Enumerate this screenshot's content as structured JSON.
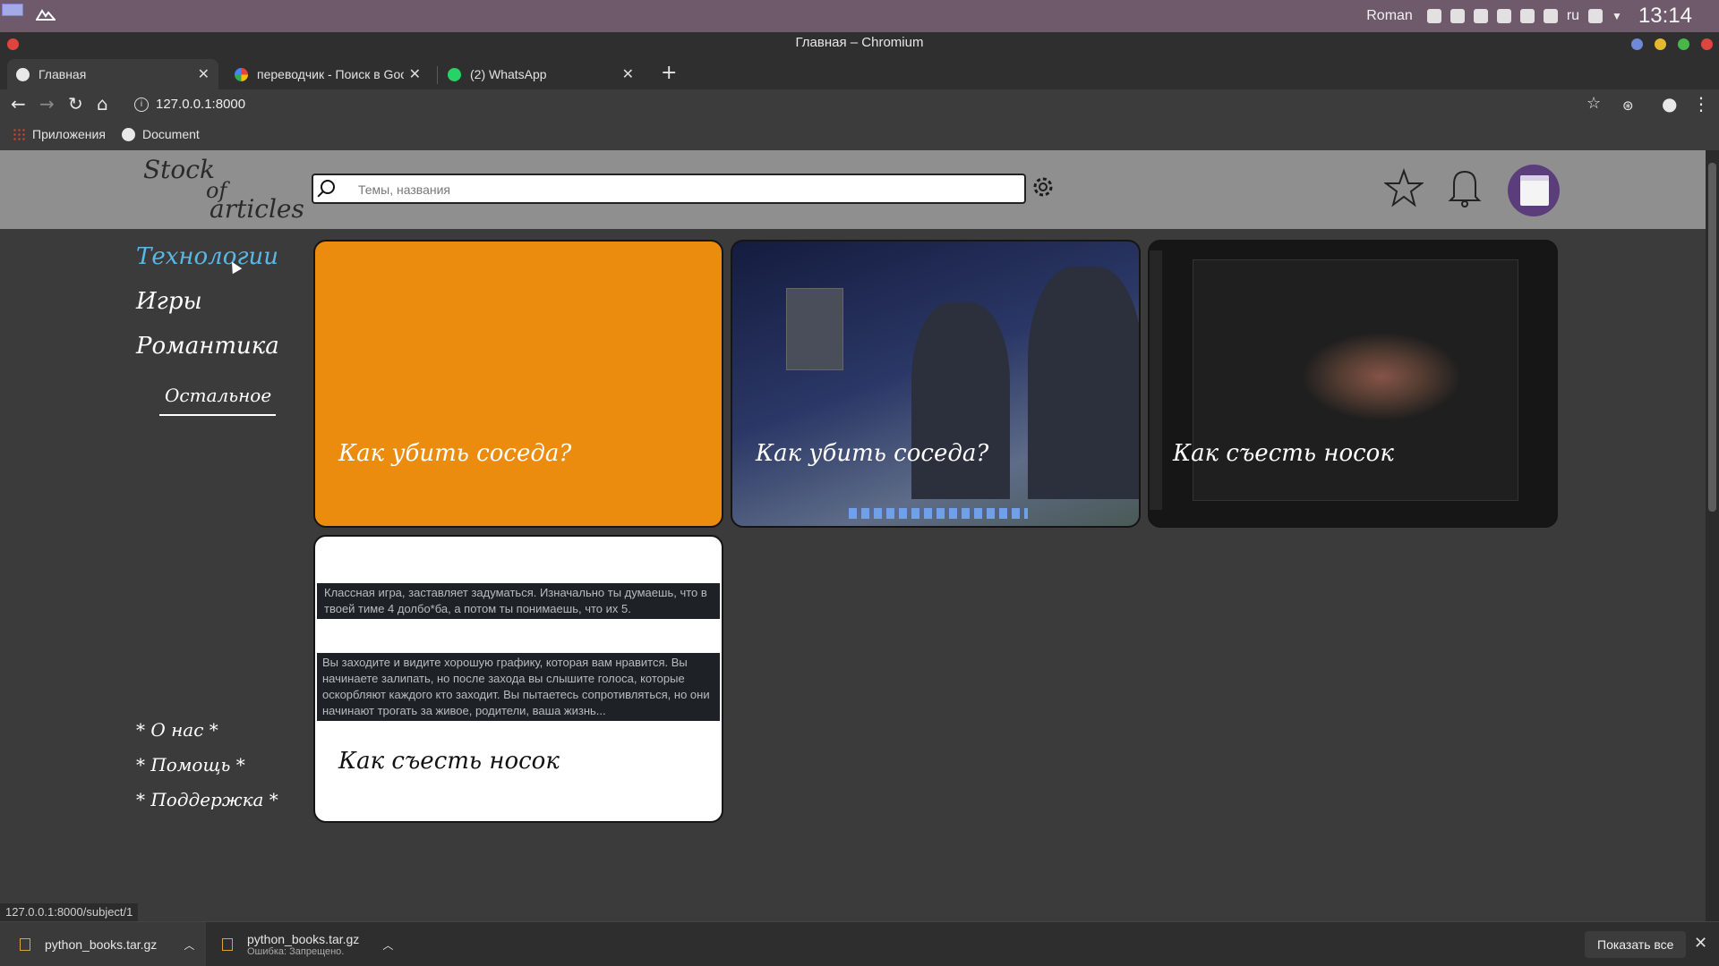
{
  "system": {
    "user": "Roman",
    "lang": "ru",
    "clock": "13:14",
    "tray_icons": [
      "bell-icon",
      "shield-icon",
      "discord-icon",
      "clipboard-icon",
      "volume-icon",
      "battery-icon",
      "wifi-icon",
      "chevron-down-icon"
    ]
  },
  "window": {
    "title": "Главная – Chromium"
  },
  "tabs": [
    {
      "label": "Главная",
      "favicon": "django-icon",
      "active": true
    },
    {
      "label": "переводчик - Поиск в Googl",
      "favicon": "google-icon",
      "active": false
    },
    {
      "label": "(2) WhatsApp",
      "favicon": "whatsapp-icon",
      "active": false
    }
  ],
  "toolbar": {
    "url": "127.0.0.1:8000"
  },
  "bookmarks": [
    {
      "label": "Приложения",
      "icon": "apps-grid-icon"
    },
    {
      "label": "Document",
      "icon": "globe-icon"
    }
  ],
  "site": {
    "logo": {
      "word1": "Stock",
      "word2": "of",
      "word3": "articles"
    },
    "search": {
      "placeholder": "Темы, названия",
      "value": ""
    },
    "nav": [
      {
        "label": "Технологии",
        "active": true
      },
      {
        "label": "Игры",
        "active": false
      },
      {
        "label": "Романтика",
        "active": false
      },
      {
        "label": "Остальное",
        "active": false
      }
    ],
    "footer_links": [
      "* О нас *",
      "* Помощь *",
      "* Поддержка *"
    ],
    "cards": [
      {
        "title": "Как убить соседа?",
        "background": "#ec8c0f"
      },
      {
        "title": "Как убить соседа?",
        "background": "image"
      },
      {
        "title": "Как съесть носок",
        "background": "image"
      },
      {
        "title": "Как съесть носок",
        "comments": [
          "Классная игра, заставляет задуматься. Изначально ты думаешь, что в твоей тиме 4 долбо*ба, а потом ты понимаешь, что их 5.",
          "Вы заходите и видите хорошую графику, которая вам нравится. Вы начинаете залипать, но после захода вы слышите голоса, которые оскорбляют каждого кто заходит. Вы пытаетесь сопротивляться, но они начинают трогать за живое, родители, ваша жизнь..."
        ]
      }
    ]
  },
  "status_url": "127.0.0.1:8000/subject/1",
  "downloads": {
    "items": [
      {
        "name": "python_books.tar.gz",
        "error": ""
      },
      {
        "name": "python_books.tar.gz",
        "error": "Ошибка: Запрещено."
      }
    ],
    "show_all": "Показать все"
  },
  "colors": {
    "accent_nav": "#5bb8e6",
    "card_orange": "#ec8c0f",
    "header_gray": "#8f8f8f"
  }
}
